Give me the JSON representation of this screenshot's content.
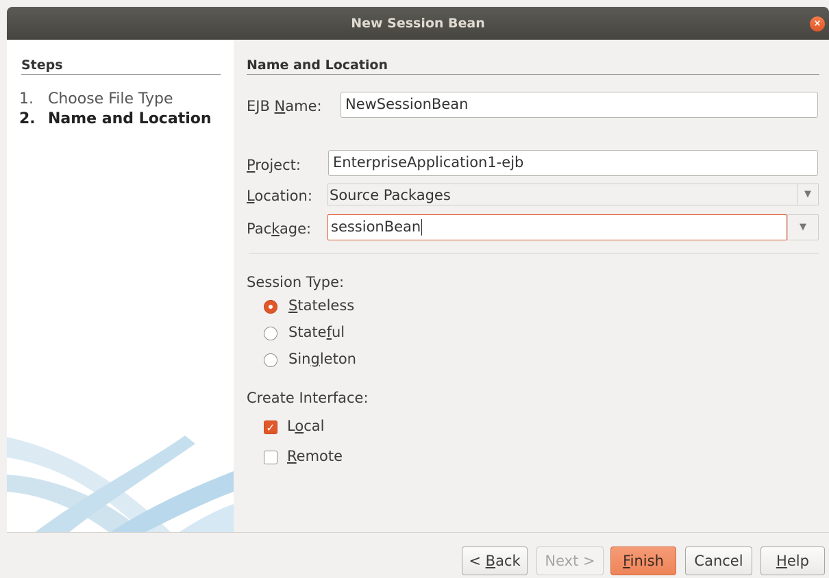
{
  "window": {
    "title": "New Session Bean",
    "close_glyph": "×"
  },
  "steps": {
    "header": "Steps",
    "items": [
      {
        "num": "1.",
        "label": "Choose File Type"
      },
      {
        "num": "2.",
        "label": "Name and Location"
      }
    ]
  },
  "section": {
    "header": "Name and Location"
  },
  "form": {
    "ejb_name": {
      "label_pre": "EJB ",
      "label_mnemonic": "N",
      "label_post": "ame:",
      "value": "NewSessionBean"
    },
    "project": {
      "label_mnemonic": "P",
      "label_post": "roject:",
      "value": "EnterpriseApplication1-ejb"
    },
    "location": {
      "label_mnemonic": "L",
      "label_post": "ocation:",
      "value": "Source Packages"
    },
    "package": {
      "label_pre": "Pac",
      "label_mnemonic": "k",
      "label_post": "age:",
      "value": "sessionBean"
    }
  },
  "session_type": {
    "label": "Session Type:",
    "options": [
      {
        "pre": "",
        "mnemonic": "S",
        "post": "tateless",
        "selected": true
      },
      {
        "pre": "State",
        "mnemonic": "f",
        "post": "ul",
        "selected": false
      },
      {
        "pre": "Sin",
        "mnemonic": "g",
        "post": "leton",
        "selected": false
      }
    ]
  },
  "create_interface": {
    "label": "Create Interface:",
    "options": [
      {
        "pre": "L",
        "mnemonic": "o",
        "post": "cal",
        "checked": true
      },
      {
        "pre": "",
        "mnemonic": "R",
        "post": "emote",
        "checked": false
      }
    ]
  },
  "buttons": {
    "back": {
      "pre": "< ",
      "mnemonic": "B",
      "post": "ack"
    },
    "next": "Next >",
    "finish": {
      "mnemonic": "F",
      "post": "inish"
    },
    "cancel": "Cancel",
    "help": {
      "mnemonic": "H",
      "post": "elp"
    }
  },
  "icons": {
    "dropdown_glyph": "▼",
    "check_glyph": "✓"
  },
  "colors": {
    "accent": "#e0572a",
    "titlebar": "#4f4e49"
  }
}
